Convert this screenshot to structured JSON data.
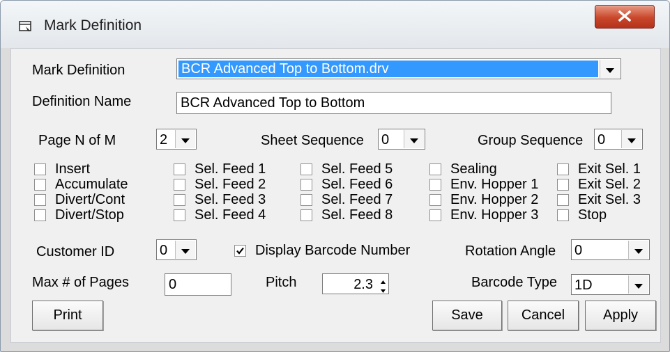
{
  "window": {
    "title": "Mark Definition"
  },
  "form": {
    "mark_definition_label": "Mark Definition",
    "mark_definition_value": "BCR Advanced Top to Bottom.drv",
    "definition_name_label": "Definition Name",
    "definition_name_value": "BCR Advanced Top to Bottom",
    "page_n_of_m_label": "Page N of M",
    "page_n_of_m_value": "2",
    "sheet_sequence_label": "Sheet Sequence",
    "sheet_sequence_value": "0",
    "group_sequence_label": "Group Sequence",
    "group_sequence_value": "0",
    "customer_id_label": "Customer ID",
    "customer_id_value": "0",
    "display_barcode_label": "Display Barcode Number",
    "display_barcode_checked": true,
    "rotation_angle_label": "Rotation Angle",
    "rotation_angle_value": "0",
    "max_pages_label": "Max # of Pages",
    "max_pages_value": "0",
    "pitch_label": "Pitch",
    "pitch_value": "2.3",
    "barcode_type_label": "Barcode Type",
    "barcode_type_value": "1D"
  },
  "checkboxes": {
    "col1": [
      "Insert",
      "Accumulate",
      "Divert/Cont",
      "Divert/Stop"
    ],
    "col2": [
      "Sel. Feed 1",
      "Sel. Feed 2",
      "Sel. Feed 3",
      "Sel. Feed 4"
    ],
    "col3": [
      "Sel. Feed 5",
      "Sel. Feed 6",
      "Sel. Feed 7",
      "Sel. Feed 8"
    ],
    "col4": [
      "Sealing",
      "Env. Hopper 1",
      "Env. Hopper 2",
      "Env. Hopper 3"
    ],
    "col5": [
      "Exit Sel. 1",
      "Exit Sel. 2",
      "Exit Sel. 3",
      "Stop"
    ]
  },
  "buttons": {
    "print": "Print",
    "save": "Save",
    "cancel": "Cancel",
    "apply": "Apply"
  },
  "icons": {
    "window": "window-icon",
    "close": "close-icon"
  },
  "colors": {
    "selection": "#3399ff",
    "close_button": "#c9472b"
  }
}
